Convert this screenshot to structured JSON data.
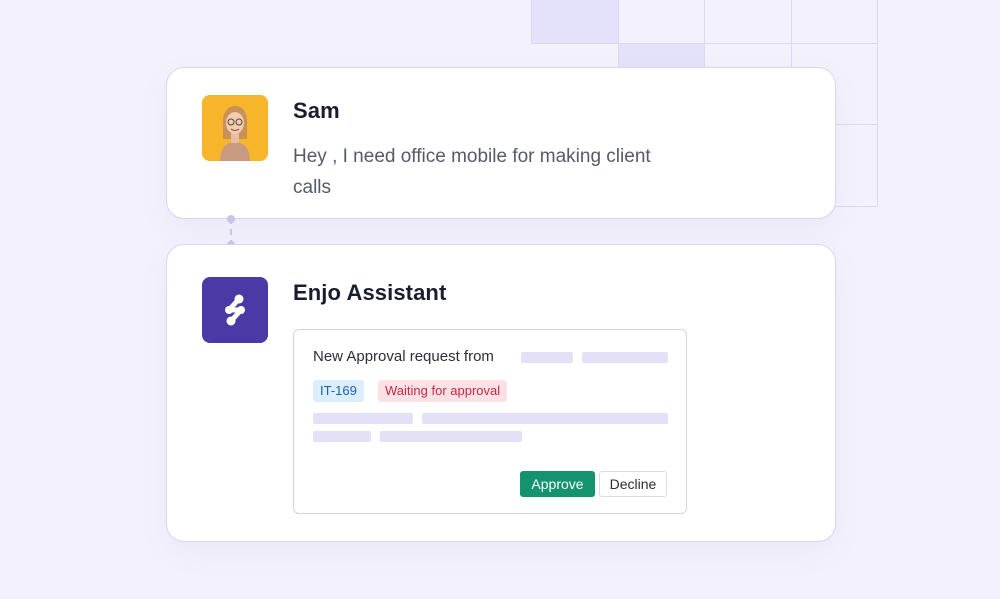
{
  "messages": {
    "user": {
      "name": "Sam",
      "text": "Hey , I need office mobile for making client calls",
      "avatar_color": "#f7b52b"
    },
    "assistant": {
      "name": "Enjo Assistant",
      "logo_color": "#4b3aa5"
    }
  },
  "approval_card": {
    "title": "New Approval request from",
    "ticket_id": "IT-169",
    "status": "Waiting for approval",
    "approve_label": "Approve",
    "decline_label": "Decline"
  },
  "colors": {
    "background": "#f3f1fb",
    "approve": "#13936e",
    "status_tag_bg": "#fde1e4",
    "status_tag_text": "#c22c45",
    "id_tag_bg": "#dbeefe",
    "id_tag_text": "#1f5fa8",
    "placeholder": "#e3e0f8"
  }
}
